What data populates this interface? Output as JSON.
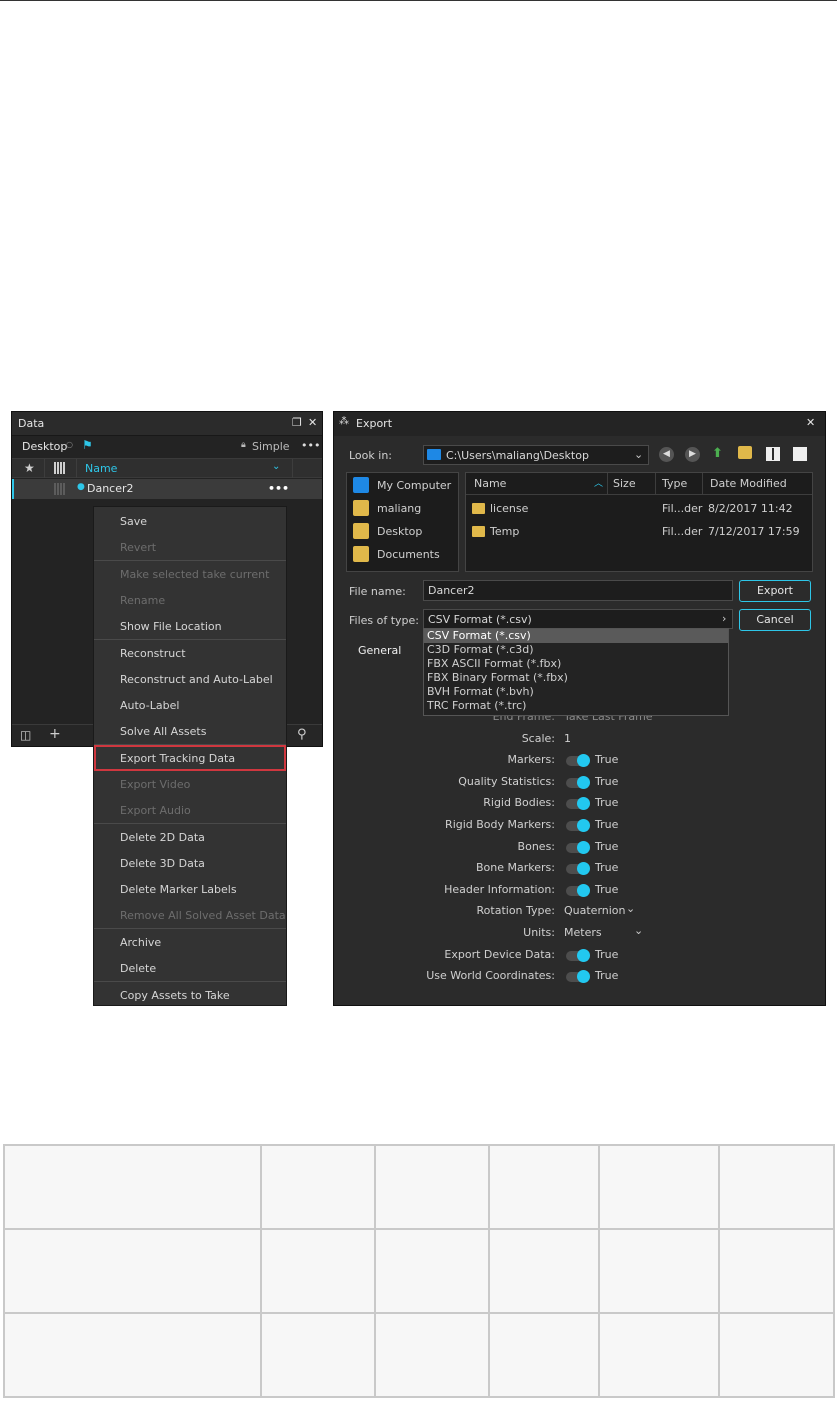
{
  "data_panel": {
    "title": "Data",
    "location": "Desktop",
    "view_mode": "Simple",
    "more_label": "•••",
    "column_name": "Name",
    "row": {
      "name": "Dancer2",
      "more_label": "•••"
    }
  },
  "context_menu": {
    "items": [
      {
        "label": "Save",
        "enabled": true
      },
      {
        "label": "Revert",
        "enabled": false
      },
      {
        "label": "Make selected take current",
        "enabled": false
      },
      {
        "label": "Rename",
        "enabled": false
      },
      {
        "label": "Show File Location",
        "enabled": true
      },
      {
        "label": "Reconstruct",
        "enabled": true
      },
      {
        "label": "Reconstruct and Auto-Label",
        "enabled": true
      },
      {
        "label": "Auto-Label",
        "enabled": true
      },
      {
        "label": "Solve All Assets",
        "enabled": true
      },
      {
        "label": "Export Tracking Data",
        "enabled": true,
        "highlighted": true
      },
      {
        "label": "Export Video",
        "enabled": false
      },
      {
        "label": "Export Audio",
        "enabled": false
      },
      {
        "label": "Delete 2D Data",
        "enabled": true
      },
      {
        "label": "Delete 3D Data",
        "enabled": true
      },
      {
        "label": "Delete Marker Labels",
        "enabled": true
      },
      {
        "label": "Remove All Solved Asset Data",
        "enabled": false
      },
      {
        "label": "Archive",
        "enabled": true
      },
      {
        "label": "Delete",
        "enabled": true
      },
      {
        "label": "Copy Assets to Take",
        "enabled": true
      }
    ]
  },
  "export_dialog": {
    "title": "Export",
    "look_in_label": "Look in:",
    "look_in_path": "C:\\Users\\maliang\\Desktop",
    "places": [
      "My Computer",
      "maliang",
      "Desktop",
      "Documents"
    ],
    "file_columns": [
      "Name",
      "Size",
      "Type",
      "Date Modified"
    ],
    "files": [
      {
        "name": "license",
        "size": "",
        "type": "Fil...der",
        "date": "8/2/2017 11:42"
      },
      {
        "name": "Temp",
        "size": "",
        "type": "Fil...der",
        "date": "7/12/2017 17:59"
      }
    ],
    "file_name_label": "File name:",
    "file_name_value": "Dancer2",
    "files_of_type_label": "Files of type:",
    "files_of_type_value": "CSV Format (*.csv)",
    "export_button": "Export",
    "cancel_button": "Cancel",
    "type_options": [
      "CSV Format (*.csv)",
      "C3D Format (*.c3d)",
      "FBX ASCII Format (*.fbx)",
      "FBX Binary Format (*.fbx)",
      "BVH Format (*.bvh)",
      "TRC Format (*.trc)"
    ],
    "general_tab": "General",
    "partial_property": {
      "label": "End Frame:",
      "value": "Take Last Frame"
    },
    "properties": [
      {
        "label": "Scale:",
        "value": "1",
        "kind": "text"
      },
      {
        "label": "Markers:",
        "value": "True",
        "kind": "toggle"
      },
      {
        "label": "Quality Statistics:",
        "value": "True",
        "kind": "toggle"
      },
      {
        "label": "Rigid Bodies:",
        "value": "True",
        "kind": "toggle"
      },
      {
        "label": "Rigid Body Markers:",
        "value": "True",
        "kind": "toggle"
      },
      {
        "label": "Bones:",
        "value": "True",
        "kind": "toggle"
      },
      {
        "label": "Bone Markers:",
        "value": "True",
        "kind": "toggle"
      },
      {
        "label": "Header Information:",
        "value": "True",
        "kind": "toggle"
      },
      {
        "label": "Rotation Type:",
        "value": "Quaternion",
        "kind": "select"
      },
      {
        "label": "Units:",
        "value": "Meters",
        "kind": "select"
      },
      {
        "label": "Export Device Data:",
        "value": "True",
        "kind": "toggle"
      },
      {
        "label": "Use World Coordinates:",
        "value": "True",
        "kind": "toggle"
      }
    ]
  },
  "colors": {
    "accent": "#2ec6e8",
    "highlight_border": "#d0373f",
    "panel_bg": "#232323",
    "dialog_bg": "#2b2b2b"
  }
}
